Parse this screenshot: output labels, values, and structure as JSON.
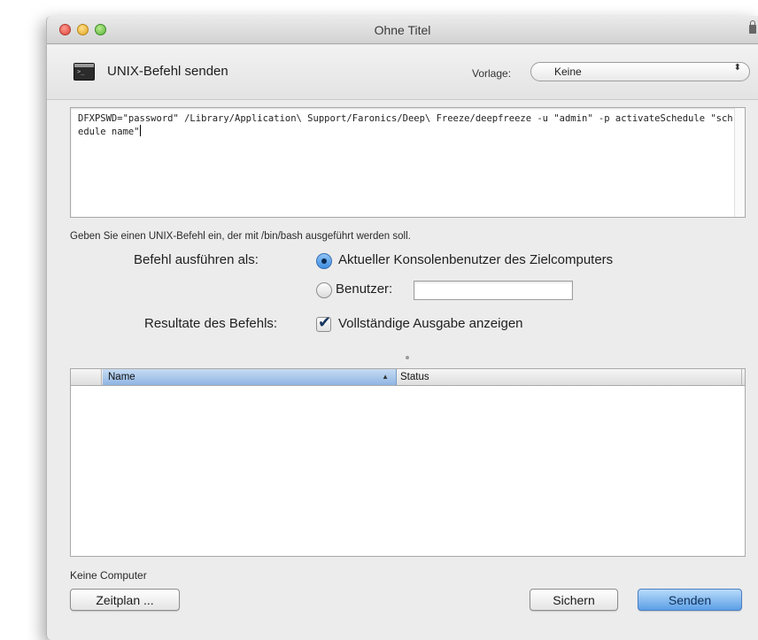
{
  "window": {
    "title": "Ohne Titel"
  },
  "header": {
    "title": "UNIX-Befehl senden",
    "template_label": "Vorlage:",
    "template_value": "Keine",
    "template_arrows": "⬍"
  },
  "command": {
    "text": "DFXPSWD=\"password\" /Library/Application\\ Support/Faronics/Deep\\ Freeze/deepfreeze -u \"admin\" -p activateSchedule \"schedule name\"",
    "hint": "Geben Sie einen UNIX-Befehl ein, der mit /bin/bash ausgeführt werden soll."
  },
  "run_as": {
    "label": "Befehl ausführen als:",
    "option_console": "Aktueller Konsolenbenutzer des Zielcomputers",
    "option_user": "Benutzer:",
    "user_value": "",
    "selected": "console"
  },
  "results": {
    "label": "Resultate des Befehls:",
    "checkbox_label": "Vollständige Ausgabe anzeigen",
    "checked": true
  },
  "table": {
    "columns": [
      "Name",
      "Status"
    ],
    "sort_glyph": "▲",
    "rows": [],
    "empty_text": "Keine Computer"
  },
  "buttons": {
    "schedule": "Zeitplan ...",
    "save": "Sichern",
    "send": "Senden"
  },
  "icons": {
    "check": "✔"
  },
  "colors": {
    "accent": "#5b9fe6",
    "window_bg": "#ececec"
  }
}
